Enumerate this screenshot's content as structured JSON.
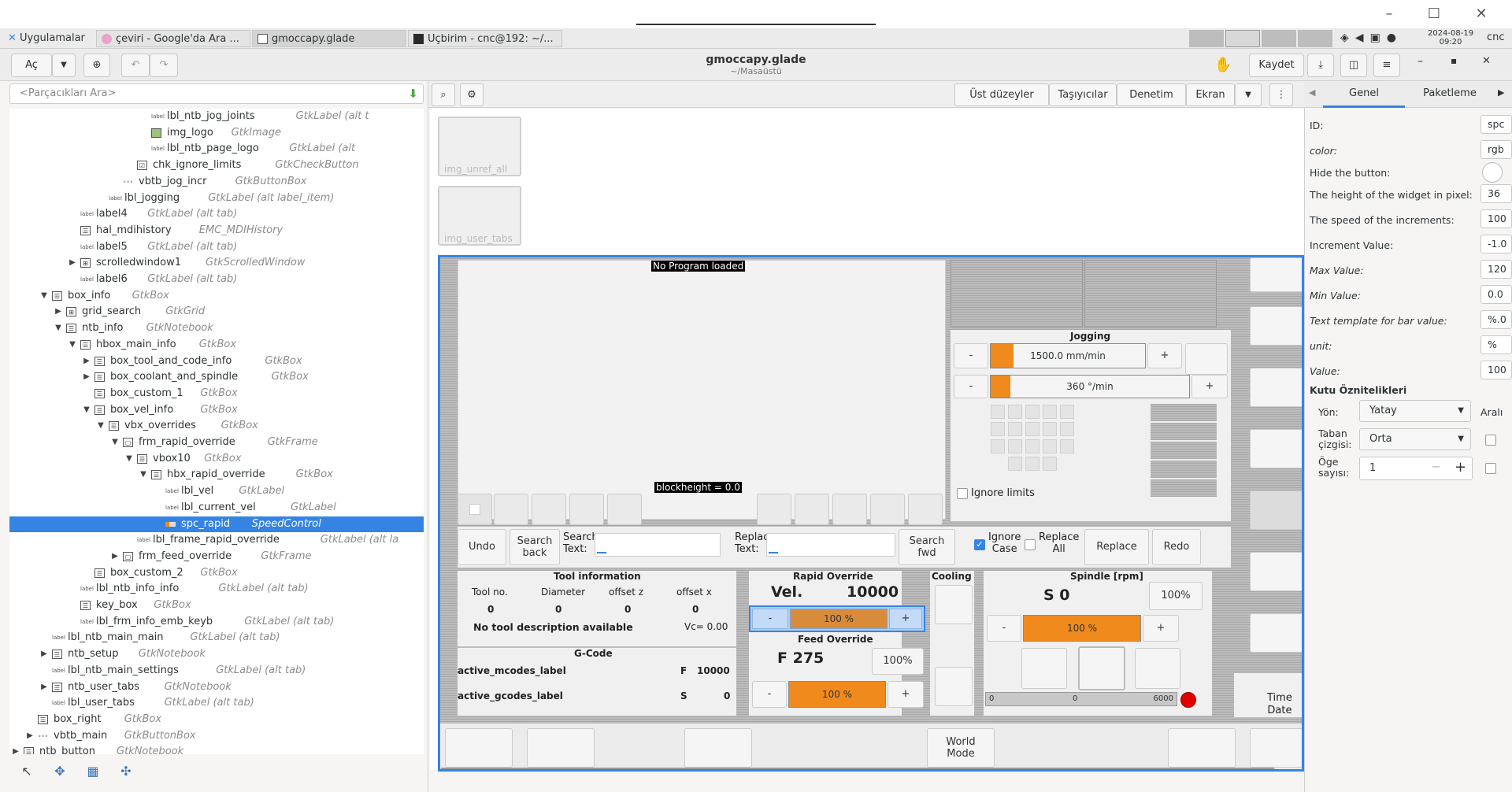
{
  "window": {
    "title": "gmoccapy.glade",
    "subtitle": "~/Masaüstü",
    "controls": [
      "–",
      "☐",
      "✕"
    ]
  },
  "taskbar": {
    "apps_label": "Uygulamalar",
    "tasks": [
      "çeviri - Google'da Ara ...",
      "gmoccapy.glade",
      "Uçbirim - cnc@192: ~/..."
    ],
    "date": "2024-08-19",
    "time": "09:20",
    "user": "cnc"
  },
  "header": {
    "open_label": "Aç",
    "save_label": "Kaydet"
  },
  "left": {
    "search_placeholder": "<Parçacıkları Ara>",
    "tree": [
      {
        "name": "lbl_ntb_jog_joints",
        "type": "GtkLabel",
        "extra": "(alt t",
        "depth": 10,
        "icon": "label",
        "arrow": ""
      },
      {
        "name": "img_logo",
        "type": "GtkImage",
        "extra": "",
        "depth": 10,
        "icon": "image",
        "arrow": ""
      },
      {
        "name": "lbl_ntb_page_logo",
        "type": "GtkLabel",
        "extra": "(alt",
        "depth": 10,
        "icon": "label",
        "arrow": ""
      },
      {
        "name": "chk_ignore_limits",
        "type": "GtkCheckButton",
        "extra": "",
        "depth": 9,
        "icon": "check",
        "arrow": ""
      },
      {
        "name": "vbtb_jog_incr",
        "type": "GtkButtonBox",
        "extra": "",
        "depth": 8,
        "icon": "dots",
        "arrow": ""
      },
      {
        "name": "lbl_jogging",
        "type": "GtkLabel",
        "extra": "(alt label_item)",
        "depth": 7,
        "icon": "label",
        "arrow": ""
      },
      {
        "name": "label4",
        "type": "GtkLabel",
        "extra": "(alt tab)",
        "depth": 5,
        "icon": "label",
        "arrow": ""
      },
      {
        "name": "hal_mdihistory",
        "type": "EMC_MDIHistory",
        "extra": "",
        "depth": 5,
        "icon": "box",
        "arrow": ""
      },
      {
        "name": "label5",
        "type": "GtkLabel",
        "extra": "(alt tab)",
        "depth": 5,
        "icon": "label",
        "arrow": ""
      },
      {
        "name": "scrolledwindow1",
        "type": "GtkScrolledWindow",
        "extra": "",
        "depth": 5,
        "icon": "grid",
        "arrow": "▶"
      },
      {
        "name": "label6",
        "type": "GtkLabel",
        "extra": "(alt tab)",
        "depth": 5,
        "icon": "label",
        "arrow": ""
      },
      {
        "name": "box_info",
        "type": "GtkBox",
        "extra": "",
        "depth": 3,
        "icon": "box",
        "arrow": "▼"
      },
      {
        "name": "grid_search",
        "type": "GtkGrid",
        "extra": "",
        "depth": 4,
        "icon": "grid",
        "arrow": "▶"
      },
      {
        "name": "ntb_info",
        "type": "GtkNotebook",
        "extra": "",
        "depth": 4,
        "icon": "box",
        "arrow": "▼"
      },
      {
        "name": "hbox_main_info",
        "type": "GtkBox",
        "extra": "",
        "depth": 5,
        "icon": "box",
        "arrow": "▼"
      },
      {
        "name": "box_tool_and_code_info",
        "type": "GtkBox",
        "extra": "",
        "depth": 6,
        "icon": "box",
        "arrow": "▶"
      },
      {
        "name": "box_coolant_and_spindle",
        "type": "GtkBox",
        "extra": "",
        "depth": 6,
        "icon": "box",
        "arrow": "▶"
      },
      {
        "name": "box_custom_1",
        "type": "GtkBox",
        "extra": "",
        "depth": 6,
        "icon": "box",
        "arrow": ""
      },
      {
        "name": "box_vel_info",
        "type": "GtkBox",
        "extra": "",
        "depth": 6,
        "icon": "box",
        "arrow": "▼"
      },
      {
        "name": "vbx_overrides",
        "type": "GtkBox",
        "extra": "",
        "depth": 7,
        "icon": "box",
        "arrow": "▼"
      },
      {
        "name": "frm_rapid_override",
        "type": "GtkFrame",
        "extra": "",
        "depth": 8,
        "icon": "frame",
        "arrow": "▼"
      },
      {
        "name": "vbox10",
        "type": "GtkBox",
        "extra": "",
        "depth": 9,
        "icon": "box",
        "arrow": "▼"
      },
      {
        "name": "hbx_rapid_override",
        "type": "GtkBox",
        "extra": "",
        "depth": 10,
        "icon": "box",
        "arrow": "▼"
      },
      {
        "name": "lbl_vel",
        "type": "GtkLabel",
        "extra": "",
        "depth": 11,
        "icon": "label",
        "arrow": ""
      },
      {
        "name": "lbl_current_vel",
        "type": "GtkLabel",
        "extra": "",
        "depth": 11,
        "icon": "label",
        "arrow": ""
      },
      {
        "name": "spc_rapid",
        "type": "SpeedControl",
        "extra": "",
        "depth": 11,
        "icon": "speed",
        "arrow": "",
        "selected": true
      },
      {
        "name": "lbl_frame_rapid_override",
        "type": "GtkLabel",
        "extra": "(alt la",
        "depth": 9,
        "icon": "label",
        "arrow": ""
      },
      {
        "name": "frm_feed_override",
        "type": "GtkFrame",
        "extra": "",
        "depth": 8,
        "icon": "frame",
        "arrow": "▶"
      },
      {
        "name": "box_custom_2",
        "type": "GtkBox",
        "extra": "",
        "depth": 6,
        "icon": "box",
        "arrow": ""
      },
      {
        "name": "lbl_ntb_info_info",
        "type": "GtkLabel",
        "extra": "(alt tab)",
        "depth": 5,
        "icon": "label",
        "arrow": ""
      },
      {
        "name": "key_box",
        "type": "GtkBox",
        "extra": "",
        "depth": 5,
        "icon": "box",
        "arrow": ""
      },
      {
        "name": "lbl_frm_info_emb_keyb",
        "type": "GtkLabel",
        "extra": "(alt tab)",
        "depth": 5,
        "icon": "label",
        "arrow": ""
      },
      {
        "name": "lbl_ntb_main_main",
        "type": "GtkLabel",
        "extra": "(alt tab)",
        "depth": 3,
        "icon": "label",
        "arrow": ""
      },
      {
        "name": "ntb_setup",
        "type": "GtkNotebook",
        "extra": "",
        "depth": 3,
        "icon": "box",
        "arrow": "▶"
      },
      {
        "name": "lbl_ntb_main_settings",
        "type": "GtkLabel",
        "extra": "(alt tab)",
        "depth": 3,
        "icon": "label",
        "arrow": ""
      },
      {
        "name": "ntb_user_tabs",
        "type": "GtkNotebook",
        "extra": "",
        "depth": 3,
        "icon": "box",
        "arrow": "▶"
      },
      {
        "name": "lbl_user_tabs",
        "type": "GtkLabel",
        "extra": "(alt tab)",
        "depth": 3,
        "icon": "label",
        "arrow": ""
      },
      {
        "name": "box_right",
        "type": "GtkBox",
        "extra": "",
        "depth": 2,
        "icon": "box",
        "arrow": ""
      },
      {
        "name": "vbtb_main",
        "type": "GtkButtonBox",
        "extra": "",
        "depth": 2,
        "icon": "dots",
        "arrow": "▶"
      },
      {
        "name": "ntb_button",
        "type": "GtkNotebook",
        "extra": "",
        "depth": 1,
        "icon": "box",
        "arrow": "▶"
      }
    ]
  },
  "center": {
    "toolbar": [
      "Üst düzeyler",
      "Taşıyıcılar",
      "Denetim",
      "Ekran"
    ],
    "unref": [
      "img_unref_all",
      "img_user_tabs"
    ]
  },
  "gmoccapy": {
    "no_program": "No Program loaded",
    "blockheight": "blockheight = 0.0",
    "jogging_title": "Jogging",
    "jog_speed": "1500.0 mm/min",
    "jog_speed_fill": 0.15,
    "jog_angular": "360 °/min",
    "jog_angular_fill": 0.1,
    "ignore_limits": "Ignore limits",
    "minus": "-",
    "plus": "+",
    "search": {
      "undo": "Undo",
      "search_back": "Search\nback",
      "search_text": "Search\nText:",
      "replace_text": "Replace\nText:",
      "search_fwd": "Search\nfwd",
      "ignore_case": "Ignore\nCase",
      "replace_all": "Replace\nAll",
      "replace": "Replace",
      "redo": "Redo"
    },
    "tool": {
      "title": "Tool information",
      "cols": [
        "Tool no.",
        "Diameter",
        "offset z",
        "offset x"
      ],
      "vals": [
        "0",
        "0",
        "0",
        "0"
      ],
      "desc": "No tool description available",
      "vc": "Vc= 0.00"
    },
    "gcode": {
      "title": "G-Code",
      "mcodes": "active_mcodes_label",
      "gcodes": "active_gcodes_label",
      "f_label": "F",
      "f_val": "10000",
      "s_label": "S",
      "s_val": "0"
    },
    "rapid": {
      "title": "Rapid Override",
      "vel_label": "Vel.",
      "vel_val": "10000",
      "pct": "100 %",
      "fill": 1.0
    },
    "feed": {
      "title": "Feed Override",
      "value": "F 275",
      "pct_btn": "100%",
      "pct": "100 %",
      "fill": 1.0
    },
    "cooling_title": "Cooling",
    "spindle": {
      "title": "Spindle [rpm]",
      "value": "S 0",
      "pct_btn": "100%",
      "pct": "100 %",
      "fill": 1.0,
      "bar_min": "0",
      "bar_mid": "0",
      "bar_max": "6000"
    },
    "time_date": "Time\nDate",
    "world_mode": "World\nMode"
  },
  "right": {
    "tabs": [
      "Genel",
      "Paketleme"
    ],
    "props": [
      {
        "label": "ID:",
        "value": "spc",
        "italic": false
      },
      {
        "label": "color:",
        "value": "rgb",
        "italic": true
      },
      {
        "label": "Hide the button:",
        "value": "",
        "italic": false
      },
      {
        "label": "The height of the widget in pixel:",
        "value": "36",
        "italic": false
      },
      {
        "label": "The speed of the increments:",
        "value": "100",
        "italic": false
      },
      {
        "label": "Increment Value:",
        "value": "-1.0",
        "italic": false
      },
      {
        "label": "Max Value:",
        "value": "120",
        "italic": true
      },
      {
        "label": "Min Value:",
        "value": "0.0",
        "italic": true
      },
      {
        "label": "Text template for bar value:",
        "value": "%.0",
        "italic": true
      },
      {
        "label": "unit:",
        "value": "%",
        "italic": true
      },
      {
        "label": "Value:",
        "value": "100",
        "italic": true
      }
    ],
    "section": "Kutu Öznitelikleri",
    "yon_label": "Yön:",
    "yon_value": "Yatay",
    "aralik": "Aralı",
    "taban_label": "Taban\nçizgisi:",
    "taban_value": "Orta",
    "oge_label": "Öge\nsayısı:",
    "oge_value": "1"
  },
  "colors": {
    "accent": "#3584e4",
    "orange": "#f18a1d",
    "desktop": "#1e6fcf"
  }
}
